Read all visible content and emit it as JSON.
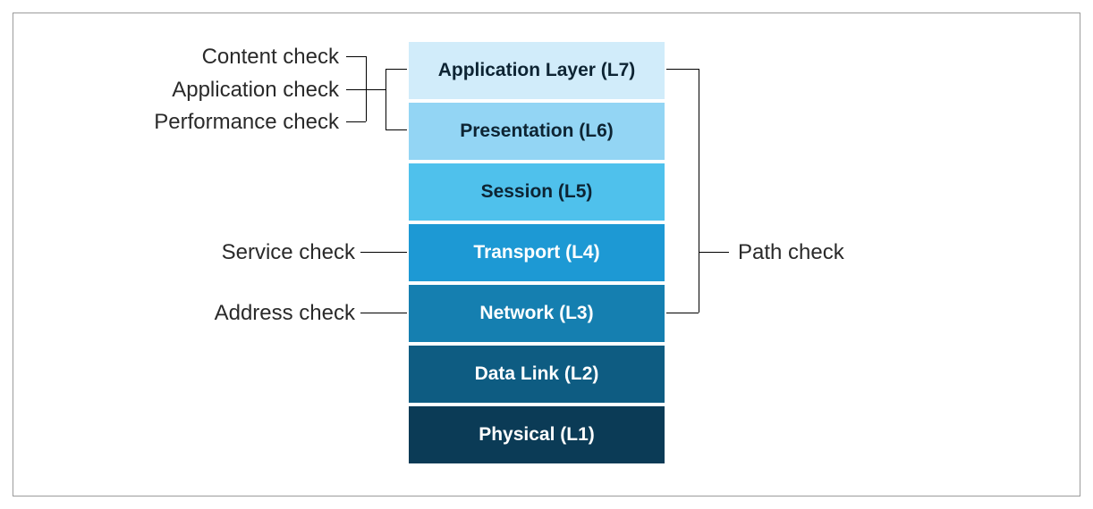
{
  "layers": {
    "l7": {
      "label": "Application Layer (L7)",
      "color": "#d1ecfa",
      "text_color": "#0d2433"
    },
    "l6": {
      "label": "Presentation (L6)",
      "color": "#93d5f4",
      "text_color": "#0d2433"
    },
    "l5": {
      "label": "Session (L5)",
      "color": "#4fc1ec",
      "text_color": "#0d2433"
    },
    "l4": {
      "label": "Transport (L4)",
      "color": "#1d99d4",
      "text_color": "#ffffff"
    },
    "l3": {
      "label": "Network (L3)",
      "color": "#157fb0",
      "text_color": "#ffffff"
    },
    "l2": {
      "label": "Data Link (L2)",
      "color": "#0e5c82",
      "text_color": "#ffffff"
    },
    "l1": {
      "label": "Physical (L1)",
      "color": "#0b3b56",
      "text_color": "#ffffff"
    }
  },
  "left_checks": {
    "content_check": "Content check",
    "application_check": "Application check",
    "performance_check": "Performance check",
    "service_check": "Service check",
    "address_check": "Address check"
  },
  "right_checks": {
    "path_check": "Path check"
  },
  "relationships": {
    "content_check_targets": [
      "l7",
      "l6"
    ],
    "application_check_targets": [
      "l7",
      "l6"
    ],
    "performance_check_targets": [
      "l7",
      "l6"
    ],
    "service_check_targets": [
      "l4"
    ],
    "address_check_targets": [
      "l3"
    ],
    "path_check_targets": [
      "l7",
      "l6",
      "l5",
      "l4",
      "l3"
    ]
  }
}
